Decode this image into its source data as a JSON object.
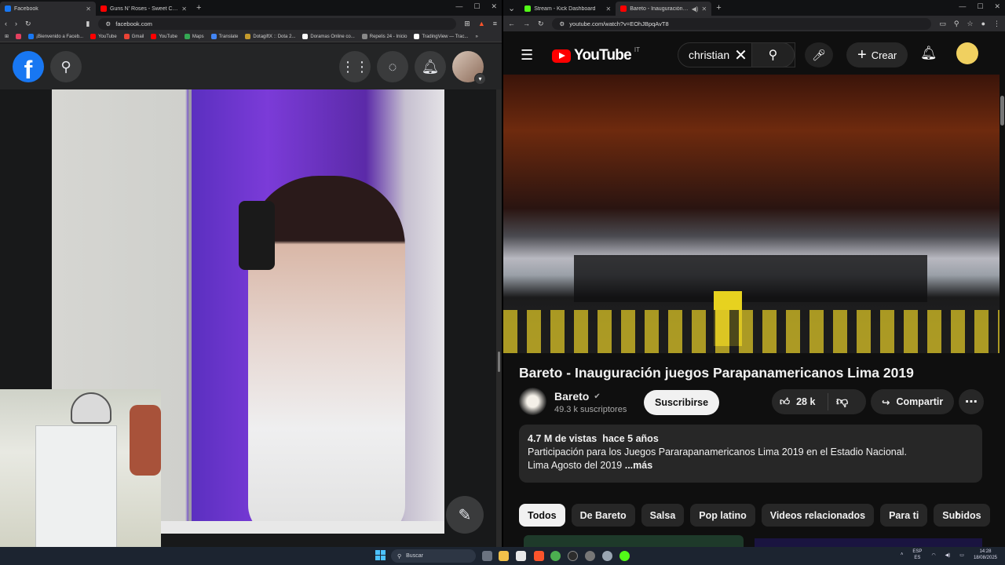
{
  "left_browser": {
    "tabs": [
      {
        "title": "Facebook",
        "fav_color": "#1877f2",
        "active": true
      },
      {
        "title": "Guns N' Roses - Sweet Child O' Mine",
        "fav_color": "#ff0000",
        "active": false
      }
    ],
    "url": "facebook.com",
    "bookmarks": [
      {
        "label": "",
        "fav_color": "#e4405f"
      },
      {
        "label": "¡Bienvenido a Faceb...",
        "fav_color": "#1877f2"
      },
      {
        "label": "YouTube",
        "fav_color": "#ff0000"
      },
      {
        "label": "Gmail",
        "fav_color": "#ea4335"
      },
      {
        "label": "YouTube",
        "fav_color": "#ff0000"
      },
      {
        "label": "Maps",
        "fav_color": "#34a853"
      },
      {
        "label": "Translate",
        "fav_color": "#4285f4"
      },
      {
        "label": "DotagiftX :: Dota 2...",
        "fav_color": "#c49a2c"
      },
      {
        "label": "Doramas Online co...",
        "fav_color": "#ffffff"
      },
      {
        "label": "Repelis 24 - Inicio",
        "fav_color": "#888888"
      },
      {
        "label": "TradingView — Trac...",
        "fav_color": "#ffffff"
      }
    ]
  },
  "right_browser": {
    "tabs": [
      {
        "title": "Stream - Kick Dashboard",
        "fav_color": "#53fc18",
        "active": false
      },
      {
        "title": "Bareto - Inauguración jueg",
        "fav_color": "#ff0000",
        "active": true
      }
    ],
    "url": "youtube.com/watch?v=EOhJBpqAvT8"
  },
  "youtube": {
    "logo_text": "YouTube",
    "country_code": "IT",
    "search_value": "christian",
    "create_label": "Crear",
    "video_title": "Bareto - Inauguración juegos Parapanamericanos Lima 2019",
    "channel_name": "Bareto",
    "subscribers": "49.3 k suscriptores",
    "subscribe_label": "Suscribirse",
    "likes": "28 k",
    "share_label": "Compartir",
    "description": {
      "views": "4.7 M de vistas",
      "age": "hace 5 años",
      "line1": "Participación para los Juegos Pararapanamericanos Lima 2019 en el Estadio Nacional.",
      "line2": "Lima Agosto del 2019",
      "more": "...más"
    },
    "chips": [
      "Todos",
      "De Bareto",
      "Salsa",
      "Pop latino",
      "Videos relacionados",
      "Para ti",
      "Subidos"
    ]
  },
  "taskbar": {
    "search_placeholder": "Buscar",
    "lang_top": "ESP",
    "lang_bottom": "ES",
    "time": "14:28",
    "date": "18/08/2025"
  }
}
